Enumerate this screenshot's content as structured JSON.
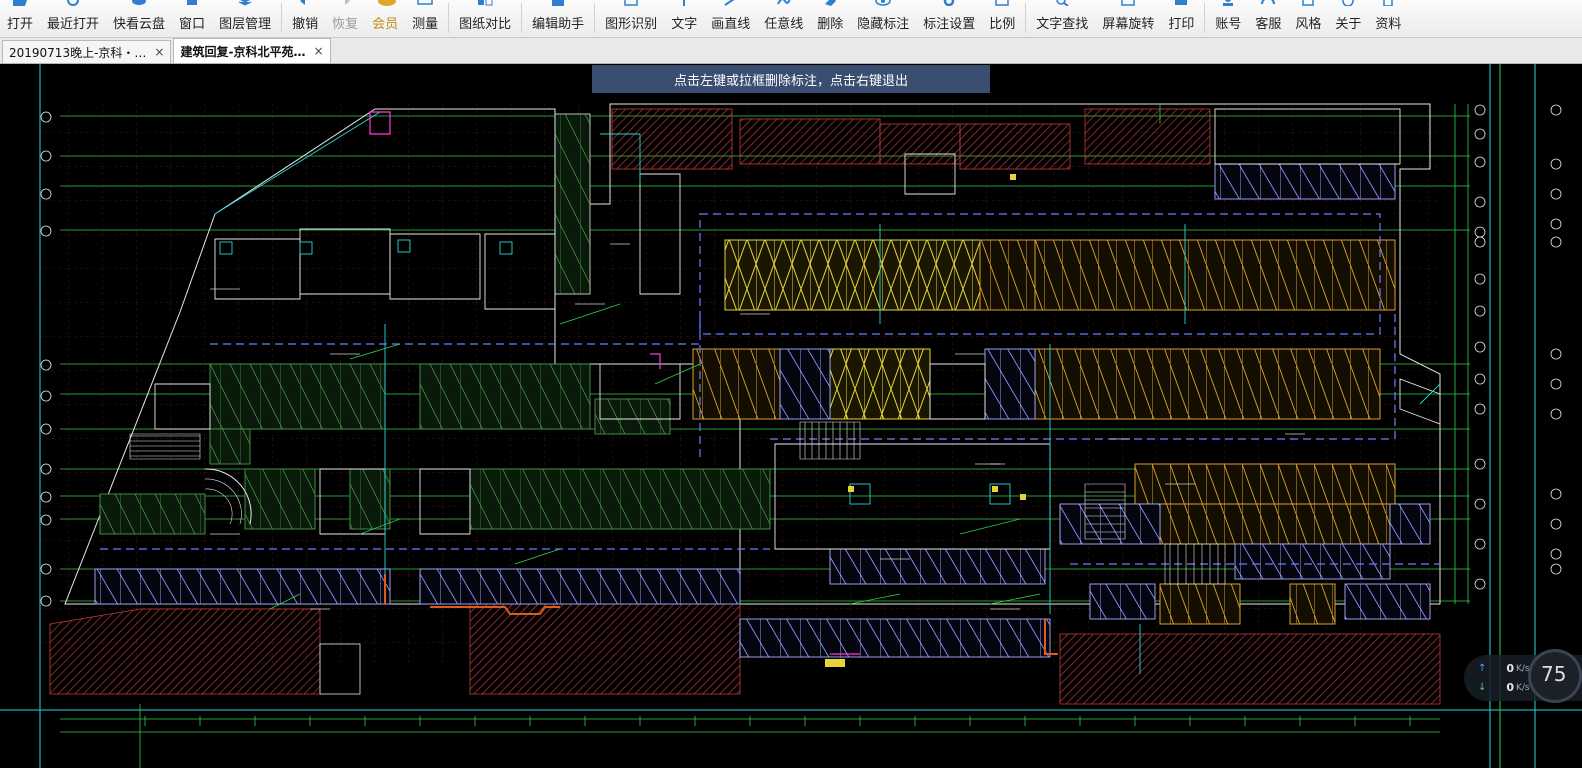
{
  "toolbar": {
    "items": [
      {
        "label": "打开",
        "icon": "folder-open-icon",
        "enabled": true
      },
      {
        "label": "最近打开",
        "icon": "recent-icon",
        "enabled": true
      },
      {
        "label": "快看云盘",
        "icon": "cloud-icon",
        "enabled": true
      },
      {
        "label": "窗口",
        "icon": "window-icon",
        "enabled": true
      },
      {
        "label": "图层管理",
        "icon": "layers-icon",
        "enabled": true
      },
      {
        "label": "撤销",
        "icon": "undo-icon",
        "enabled": true
      },
      {
        "label": "恢复",
        "icon": "redo-icon",
        "enabled": false
      },
      {
        "label": "会员",
        "icon": "vip-icon",
        "enabled": true
      },
      {
        "label": "测量",
        "icon": "ruler-icon",
        "enabled": true
      },
      {
        "label": "图纸对比",
        "icon": "compare-icon",
        "enabled": true
      },
      {
        "label": "编辑助手",
        "icon": "edit-assistant-icon",
        "enabled": true
      },
      {
        "label": "图形识别",
        "icon": "shape-recognize-icon",
        "enabled": true
      },
      {
        "label": "文字",
        "icon": "text-icon",
        "enabled": true
      },
      {
        "label": "画直线",
        "icon": "line-icon",
        "enabled": true
      },
      {
        "label": "任意线",
        "icon": "freehand-icon",
        "enabled": true
      },
      {
        "label": "删除",
        "icon": "eraser-icon",
        "enabled": true
      },
      {
        "label": "隐藏标注",
        "icon": "eye-icon",
        "enabled": true
      },
      {
        "label": "标注设置",
        "icon": "settings-icon",
        "enabled": true
      },
      {
        "label": "比例",
        "icon": "scale-icon",
        "enabled": true
      },
      {
        "label": "文字查找",
        "icon": "text-search-icon",
        "enabled": true
      },
      {
        "label": "屏幕旋转",
        "icon": "rotate-icon",
        "enabled": true
      },
      {
        "label": "打印",
        "icon": "printer-icon",
        "enabled": true
      },
      {
        "label": "账号",
        "icon": "user-icon",
        "enabled": true
      },
      {
        "label": "客服",
        "icon": "headset-icon",
        "enabled": true
      },
      {
        "label": "风格",
        "icon": "palette-icon",
        "enabled": true
      },
      {
        "label": "关于",
        "icon": "info-icon",
        "enabled": true
      },
      {
        "label": "资料",
        "icon": "document-icon",
        "enabled": true
      }
    ]
  },
  "tabs": [
    {
      "title": "20190713晚上-京科・…",
      "close": "×",
      "active": false
    },
    {
      "title": "建筑回复-京科北平苑…",
      "close": "×",
      "active": true
    }
  ],
  "hint": "点击左键或拉框删除标注，点击右键退出",
  "network": {
    "up_value": "0",
    "up_unit": "K/s",
    "down_value": "0",
    "down_unit": "K/s",
    "gauge": "75"
  },
  "colors": {
    "toolbar_bg": "#f0f0f0",
    "canvas_bg": "#000000",
    "hint_bg": "#3a4e72",
    "cad_red": "#c83a3a",
    "cad_yellow": "#e8d43a",
    "cad_green": "#2fd24a",
    "cad_cyan": "#27d6d6",
    "cad_blue": "#6a7cff",
    "cad_white": "#e8e8e8"
  }
}
